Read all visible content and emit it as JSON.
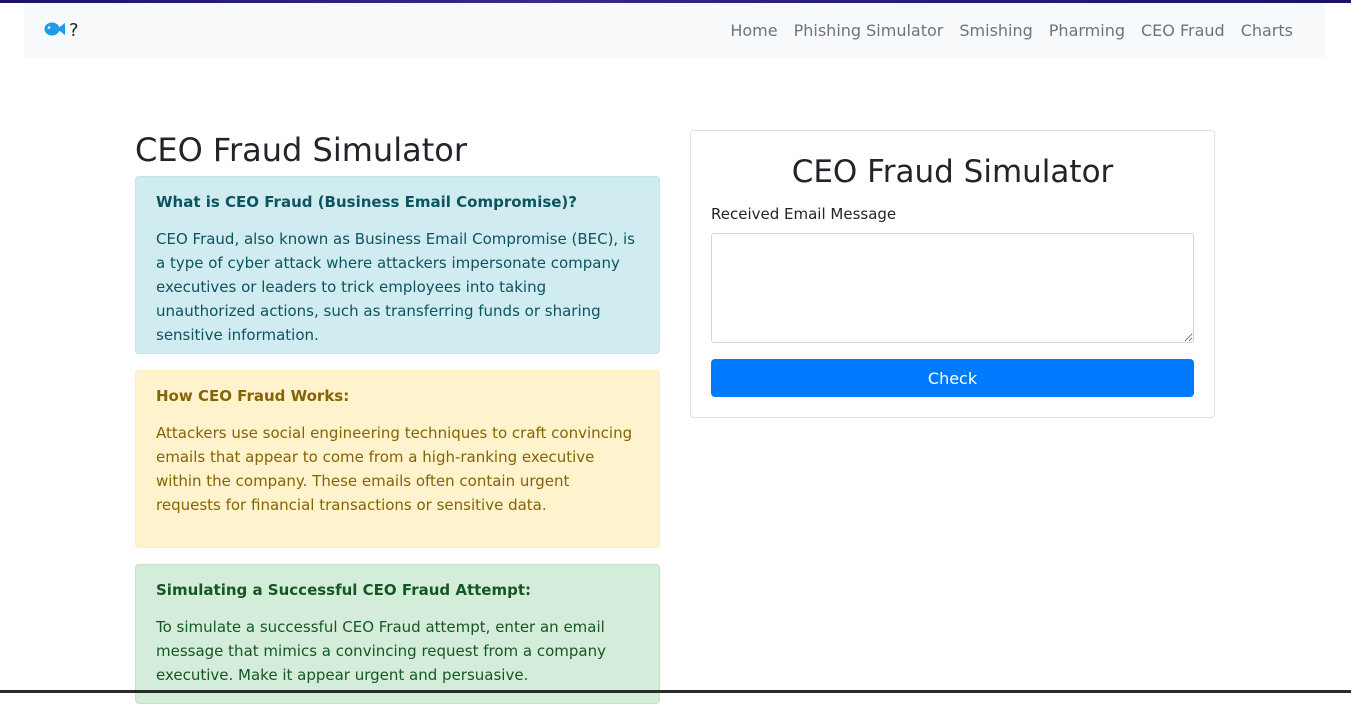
{
  "navbar": {
    "brand_icon": "fish-icon",
    "brand_text": "?",
    "links": [
      "Home",
      "Phishing Simulator",
      "Smishing",
      "Pharming",
      "CEO Fraud",
      "Charts"
    ]
  },
  "main": {
    "title": "CEO Fraud Simulator",
    "alerts": [
      {
        "heading": "What is CEO Fraud (Business Email Compromise)?",
        "body": "CEO Fraud, also known as Business Email Compromise (BEC), is a type of cyber attack where attackers impersonate company executives or leaders to trick employees into taking unauthorized actions, such as transferring funds or sharing sensitive information."
      },
      {
        "heading": "How CEO Fraud Works:",
        "body": "Attackers use social engineering techniques to craft convincing emails that appear to come from a high-ranking executive within the company. These emails often contain urgent requests for financial transactions or sensitive data."
      },
      {
        "heading": "Simulating a Successful CEO Fraud Attempt:",
        "body": "To simulate a successful CEO Fraud attempt, enter an email message that mimics a convincing request from a company executive. Make it appear urgent and persuasive."
      }
    ]
  },
  "simulator": {
    "title": "CEO Fraud Simulator",
    "field_label": "Received Email Message",
    "field_value": "",
    "button_label": "Check"
  },
  "colors": {
    "primary": "#007bff",
    "info_bg": "#d1ecf1",
    "warning_bg": "#fff3cd",
    "success_bg": "#d4edda",
    "brand_icon": "#1e9be9"
  }
}
